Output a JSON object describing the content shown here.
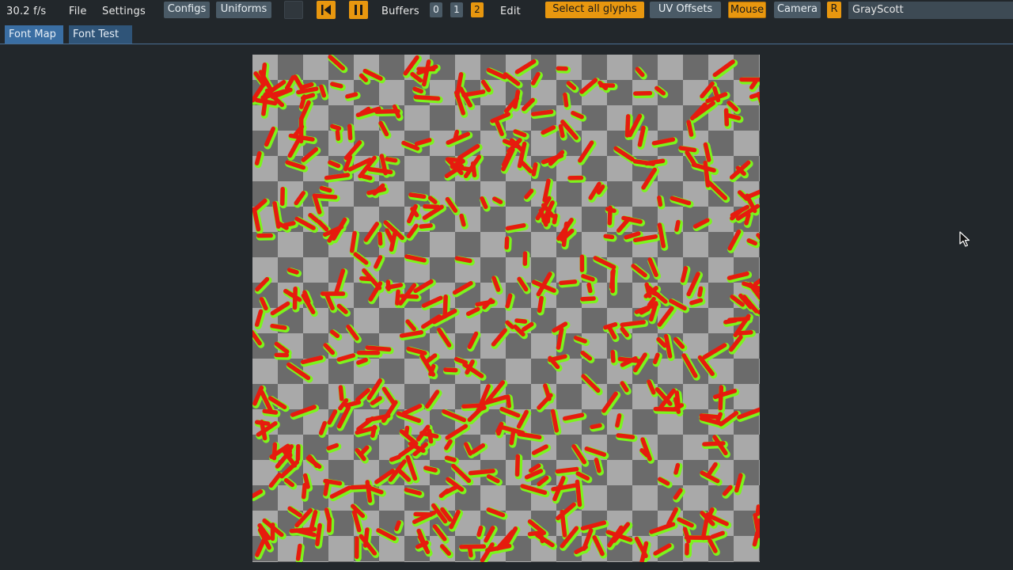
{
  "menubar": {
    "fps": "30.2 f/s",
    "file": "File",
    "settings": "Settings",
    "configs": "Configs",
    "uniforms": "Uniforms",
    "buffers_label": "Buffers",
    "buffers": [
      "0",
      "1",
      "2"
    ],
    "edit": "Edit",
    "select_all_glyphs": "Select all glyphs",
    "uv_offsets": "UV Offsets",
    "mouse": "Mouse",
    "camera": "Camera",
    "r": "R",
    "shader_name": "GrayScott"
  },
  "tabs": [
    {
      "label": "Font Map",
      "active": true
    },
    {
      "label": "Font Test",
      "active": false
    }
  ],
  "icons": {
    "rewind": "skip-to-start-icon",
    "pause": "pause-icon",
    "cursor": "mouse-pointer-icon"
  },
  "colors": {
    "accent_orange": "#e8970f",
    "tab_blue": "#3a6ea3",
    "glyph_red": "#e61b0e",
    "glyph_green": "#7cf41c"
  }
}
